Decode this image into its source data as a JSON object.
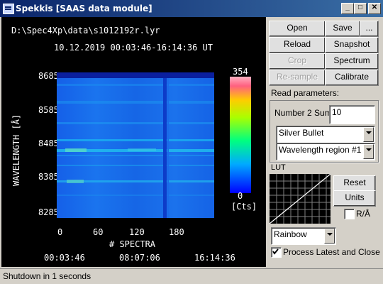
{
  "window": {
    "title": "Spekkis [SAAS data module]"
  },
  "plot": {
    "file_path": "D:\\Spec4Xp\\data\\s1012192r.lyr",
    "time_range": "10.12.2019 00:03:46-16:14:36 UT",
    "y_label": "WAVELENGTH [Å]",
    "y_ticks": [
      "8685",
      "8585",
      "8485",
      "8385",
      "8285"
    ],
    "x_label": "# SPECTRA",
    "x_ticks": [
      "0",
      "60",
      "120",
      "180"
    ],
    "time_ticks": [
      "00:03:46",
      "08:07:06",
      "16:14:36"
    ],
    "colorbar_max": "354",
    "colorbar_min": "0",
    "colorbar_unit": "[Cts]"
  },
  "buttons": {
    "open": "Open",
    "save": "Save",
    "more": "...",
    "reload": "Reload",
    "snapshot": "Snapshot",
    "crop": "Crop",
    "spectrum": "Spectrum",
    "resample": "Re-sample",
    "calibrate": "Calibrate",
    "reset": "Reset",
    "units": "Units"
  },
  "read_params": {
    "heading": "Read parameters:",
    "number2sum_label": "Number 2 Sum",
    "number2sum_value": "10",
    "target_value": "Silver Bullet",
    "region_value": "Wavelength region #1"
  },
  "lut": {
    "heading": "LUT",
    "colormap_value": "Rainbow",
    "ra_label": "R/Å",
    "ra_checked": false
  },
  "process_latest": {
    "label": "Process Latest and Close",
    "checked": true
  },
  "status": {
    "text": "Shutdown in 1 seconds"
  }
}
